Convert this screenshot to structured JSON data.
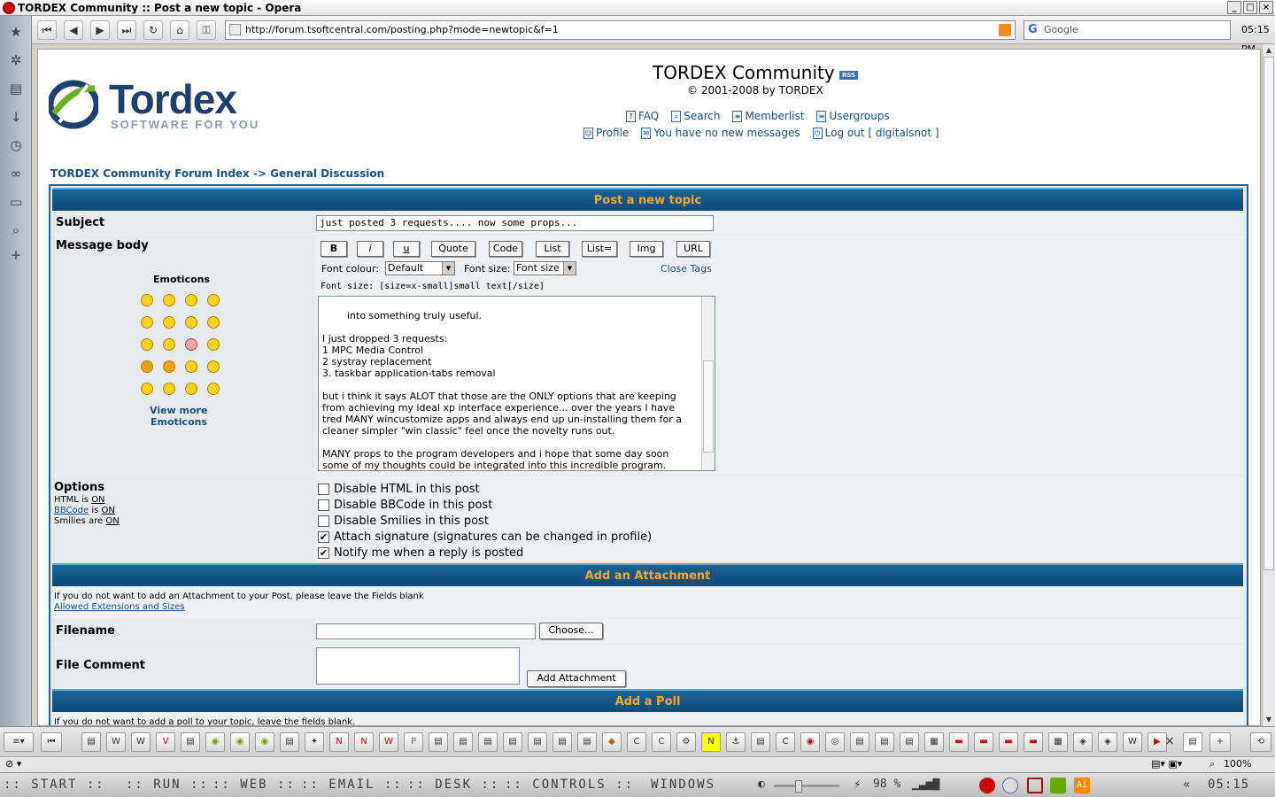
{
  "window": {
    "title": "TORDEX Community :: Post a new topic - Opera"
  },
  "browser": {
    "url": "http://forum.tsoftcentral.com/posting.php?mode=newtopic&f=1",
    "search_placeholder": "Google",
    "clock": "05:15 PM",
    "zoom": "100%"
  },
  "site": {
    "logo_word": "Tordex",
    "logo_tagline": "SOFTWARE FOR YOU",
    "title": "TORDEX Community",
    "rss": "RSS",
    "copyright": "© 2001-2008 by TORDEX",
    "nav1": [
      "FAQ",
      "Search",
      "Memberlist",
      "Usergroups"
    ],
    "nav2": [
      "Profile",
      "You have no new messages",
      "Log out [ digitalsnot ]"
    ],
    "breadcrumb": "TORDEX Community Forum Index -> General Discussion"
  },
  "post": {
    "header": "Post a new topic",
    "subject_label": "Subject",
    "subject_value": "just posted 3 requests.... now some props...",
    "body_label": "Message body",
    "emoticons_label": "Emoticons",
    "view_more": "View more",
    "view_more2": "Emoticons",
    "bbcode_buttons": [
      "B",
      "i",
      "u",
      "Quote",
      "Code",
      "List",
      "List=",
      "Img",
      "URL"
    ],
    "font_colour_label": "Font colour:",
    "font_colour_value": "Default",
    "font_size_label": "Font size:",
    "font_size_value": "Font size",
    "close_tags": "Close Tags",
    "hint": "Font size: [size=x-small]small text[/size]",
    "message": "into something truly useful.\n\nI just dropped 3 requests:\n1 MPC Media Control\n2 systray replacement\n3. taskbar application-tabs removal\n\nbut i think it says ALOT that those are the ONLY options that are keeping\nfrom achieving my ideal xp interface experience... over the years I have\ntred MANY wincustomize apps and always end up un-installing them for a\ncleaner simpler \"win classic\" feel once the novelty runs out.\n\nMANY props to the program developers and i hope that some day soon\nsome of my thoughts could be integrated into this incredible program.",
    "options_label": "Options",
    "html_status_label": "HTML is",
    "html_status": "ON",
    "bbcode_link": "BBCode",
    "bbcode_is": "is",
    "bbcode_status": "ON",
    "smilies_label": "Smilies are",
    "smilies_status": "ON",
    "options": [
      {
        "label": "Disable HTML in this post",
        "checked": false
      },
      {
        "label": "Disable BBCode in this post",
        "checked": false
      },
      {
        "label": "Disable Smilies in this post",
        "checked": false
      },
      {
        "label": "Attach signature (signatures can be changed in profile)",
        "checked": true
      },
      {
        "label": "Notify me when a reply is posted",
        "checked": true
      }
    ]
  },
  "attachment": {
    "header": "Add an Attachment",
    "note": "If you do not want to add an Attachment to your Post, please leave the Fields blank",
    "allowed_link": "Allowed Extensions and Sizes",
    "filename_label": "Filename",
    "choose_button": "Choose...",
    "comment_label": "File Comment",
    "add_button": "Add Attachment"
  },
  "poll": {
    "header": "Add a Poll",
    "note": "If you do not want to add a poll to your topic, leave the fields blank."
  },
  "taskbar": {
    "items": [
      ":: START ::",
      ":: RUN ::",
      ":: WEB ::",
      ":: EMAIL ::",
      ":: DESK ::",
      ":: CONTROLS ::",
      "WINDOWS"
    ],
    "battery": "98 %",
    "time": "05:15"
  },
  "colors": {
    "header_bg": "#1a6496",
    "header_text": "#ffa734",
    "link": "#1a4f80"
  }
}
